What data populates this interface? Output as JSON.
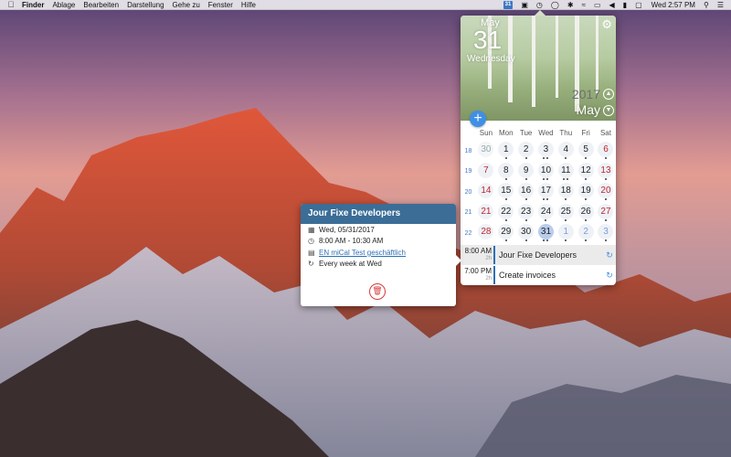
{
  "menubar": {
    "apple_icon": "apple-icon",
    "app_name": "Finder",
    "menus": [
      "Ablage",
      "Bearbeiten",
      "Darstellung",
      "Gehe zu",
      "Fenster",
      "Hilfe"
    ],
    "calendar_icon_day": "31",
    "clock": "Wed 2:57 PM"
  },
  "calendar": {
    "month_small": "May",
    "day_big": "31",
    "weekday": "Wednesday",
    "year": "2017",
    "month_nav": "May",
    "add_label": "+",
    "weekday_headers": [
      "Sun",
      "Mon",
      "Tue",
      "Wed",
      "Thu",
      "Fri",
      "Sat"
    ],
    "weeks": [
      {
        "week": "18",
        "days": [
          {
            "d": "30",
            "o": true,
            "dots": 0
          },
          {
            "d": "1",
            "dots": 1
          },
          {
            "d": "2",
            "dots": 1
          },
          {
            "d": "3",
            "dots": 2
          },
          {
            "d": "4",
            "dots": 1
          },
          {
            "d": "5",
            "dots": 1
          },
          {
            "d": "6",
            "dots": 1
          }
        ]
      },
      {
        "week": "19",
        "days": [
          {
            "d": "7",
            "dots": 0
          },
          {
            "d": "8",
            "dots": 1
          },
          {
            "d": "9",
            "dots": 1
          },
          {
            "d": "10",
            "dots": 2
          },
          {
            "d": "11",
            "dots": 2
          },
          {
            "d": "12",
            "dots": 1
          },
          {
            "d": "13",
            "dots": 1
          }
        ]
      },
      {
        "week": "20",
        "days": [
          {
            "d": "14",
            "dots": 0
          },
          {
            "d": "15",
            "dots": 1
          },
          {
            "d": "16",
            "dots": 1
          },
          {
            "d": "17",
            "dots": 2
          },
          {
            "d": "18",
            "dots": 1
          },
          {
            "d": "19",
            "dots": 1
          },
          {
            "d": "20",
            "dots": 1
          }
        ]
      },
      {
        "week": "21",
        "days": [
          {
            "d": "21",
            "dots": 0
          },
          {
            "d": "22",
            "dots": 1
          },
          {
            "d": "23",
            "dots": 1
          },
          {
            "d": "24",
            "dots": 1
          },
          {
            "d": "25",
            "dots": 1
          },
          {
            "d": "26",
            "dots": 1
          },
          {
            "d": "27",
            "dots": 1
          }
        ]
      },
      {
        "week": "22",
        "days": [
          {
            "d": "28",
            "dots": 0
          },
          {
            "d": "29",
            "dots": 1
          },
          {
            "d": "30",
            "dots": 1
          },
          {
            "d": "31",
            "dots": 2,
            "sel": true
          },
          {
            "d": "1",
            "n": true,
            "dots": 1
          },
          {
            "d": "2",
            "n": true,
            "dots": 1
          },
          {
            "d": "3",
            "n": true,
            "dots": 1
          }
        ]
      }
    ],
    "events": [
      {
        "time": "8:00 AM",
        "duration": "2h",
        "title": "Jour Fixe Developers",
        "active": true
      },
      {
        "time": "7:00 PM",
        "duration": "2h",
        "title": "Create invoices",
        "active": false
      }
    ]
  },
  "detail": {
    "title": "Jour Fixe Developers",
    "date": "Wed, 05/31/2017",
    "time": "8:00 AM - 10:30 AM",
    "calendar": "EN miCal Test geschäftlich",
    "recurrence": "Every week at Wed"
  },
  "colors": {
    "accent": "#3f8fe6",
    "header_blue": "#3b6d97",
    "weekend_red": "#c2232e",
    "delete_red": "#d63a3a"
  }
}
